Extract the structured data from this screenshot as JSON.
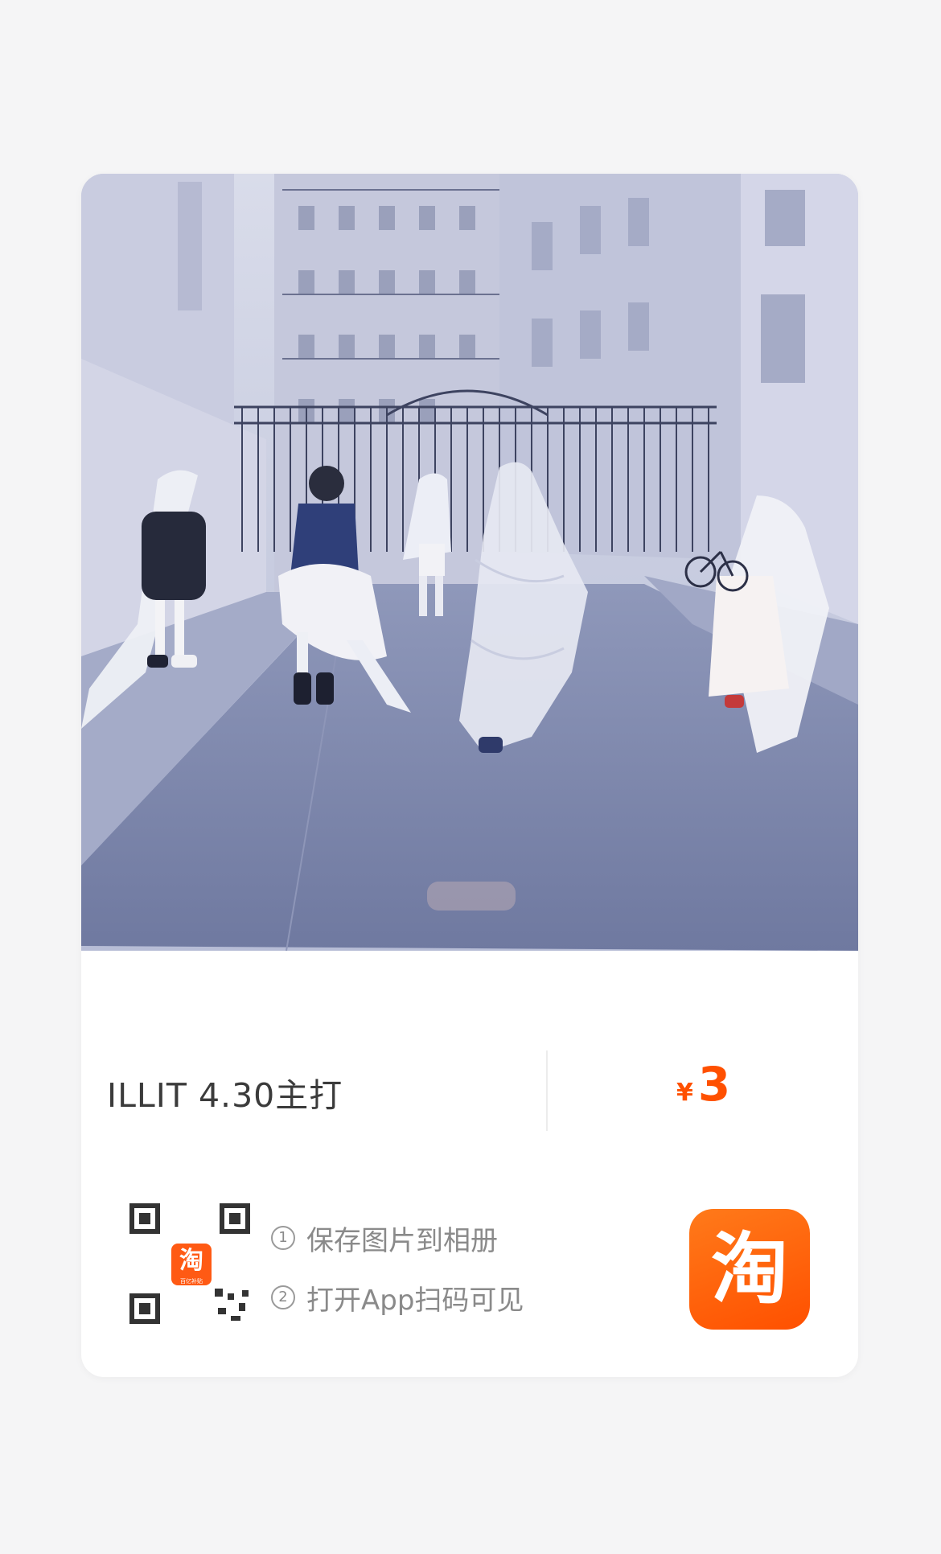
{
  "product": {
    "title": "ILLIT 4.30主打",
    "currency_symbol": "¥",
    "price": "3"
  },
  "qr_code": {
    "badge_char": "淘",
    "badge_caption": "百亿补贴"
  },
  "instructions": {
    "step1_number": "1",
    "step1_text": "保存图片到相册",
    "step2_number": "2",
    "step2_text": "打开App扫码可见"
  },
  "app_icon": {
    "char": "淘",
    "icon_name": "taobao-app-icon"
  },
  "colors": {
    "accent": "#ff5000",
    "card_bg": "#ffffff",
    "page_bg": "#f5f5f6"
  }
}
